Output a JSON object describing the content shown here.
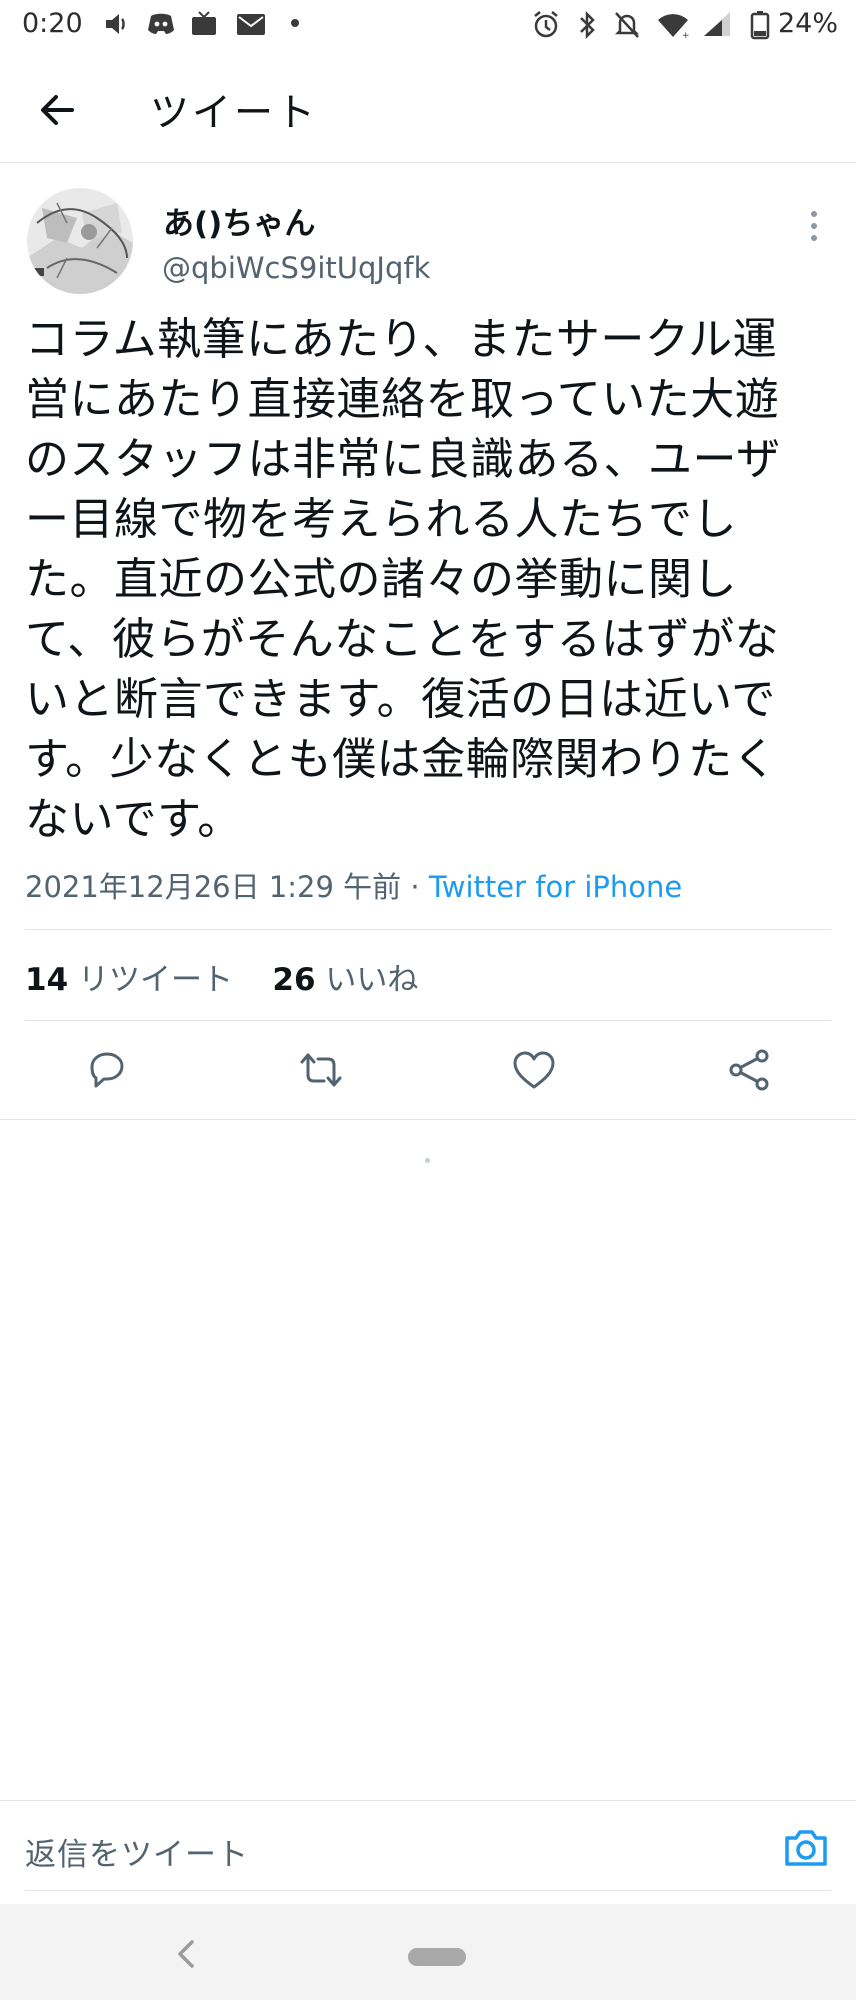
{
  "status_bar": {
    "time": "0:20",
    "battery_percent": "24%",
    "left_icons": [
      "volume-icon",
      "discord-icon",
      "tv-icon",
      "mail-icon",
      "dot-icon"
    ],
    "right_icons": [
      "alarm-icon",
      "bluetooth-icon",
      "mute-icon",
      "wifi-icon",
      "signal-icon",
      "battery-icon"
    ]
  },
  "header": {
    "title": "ツイート",
    "back_icon": "back-arrow-icon"
  },
  "tweet": {
    "display_name": "あ()ちゃん",
    "handle": "@qbiWcS9itUqJqfk",
    "text_lines": [
      "コラム執筆にあたり、またサークル運",
      "営にあたり直接連絡を取っていた大遊",
      "のスタッフは非常に良識ある、ユーザ",
      "ー目線で物を考えられる人たちでし",
      "た。直近の公式の諸々の挙動に関し",
      "て、彼らがそんなことをするはずがな",
      "いと断言できます。復活の日は近いで",
      "す。少なくとも僕は金輪際関わりたく",
      "ないです。"
    ],
    "timestamp": "2021年12月26日 1:29 午前 ·",
    "source": "Twitter for iPhone",
    "retweet_count": "14",
    "retweet_label": "リツイート",
    "like_count": "26",
    "like_label": "いいね"
  },
  "actions": [
    "reply-icon",
    "retweet-icon",
    "like-icon",
    "share-icon"
  ],
  "reply_bar": {
    "placeholder": "返信をツイート",
    "camera_icon": "camera-icon"
  },
  "colors": {
    "accent": "#1d9bf0",
    "secondary_text": "#536471",
    "primary_text": "#0f1419",
    "divider": "#e2e6e9"
  }
}
